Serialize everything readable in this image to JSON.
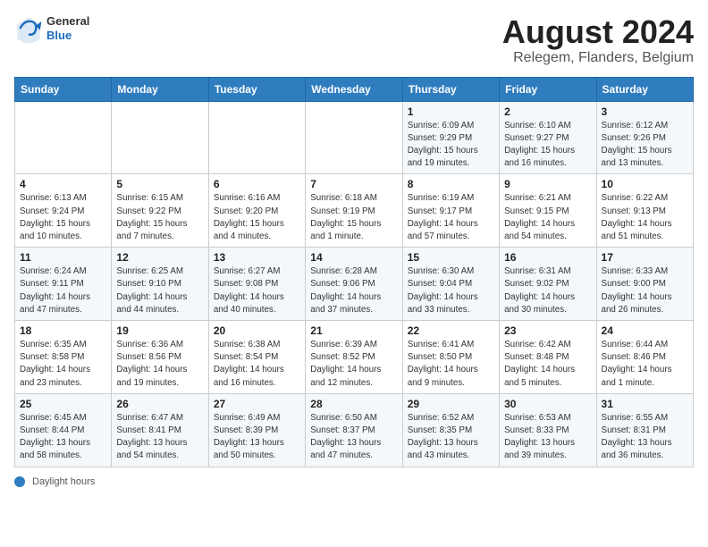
{
  "header": {
    "logo_general": "General",
    "logo_blue": "Blue",
    "month_year": "August 2024",
    "location": "Relegem, Flanders, Belgium"
  },
  "calendar": {
    "days_of_week": [
      "Sunday",
      "Monday",
      "Tuesday",
      "Wednesday",
      "Thursday",
      "Friday",
      "Saturday"
    ],
    "weeks": [
      [
        {
          "day": "",
          "info": ""
        },
        {
          "day": "",
          "info": ""
        },
        {
          "day": "",
          "info": ""
        },
        {
          "day": "",
          "info": ""
        },
        {
          "day": "1",
          "info": "Sunrise: 6:09 AM\nSunset: 9:29 PM\nDaylight: 15 hours\nand 19 minutes."
        },
        {
          "day": "2",
          "info": "Sunrise: 6:10 AM\nSunset: 9:27 PM\nDaylight: 15 hours\nand 16 minutes."
        },
        {
          "day": "3",
          "info": "Sunrise: 6:12 AM\nSunset: 9:26 PM\nDaylight: 15 hours\nand 13 minutes."
        }
      ],
      [
        {
          "day": "4",
          "info": "Sunrise: 6:13 AM\nSunset: 9:24 PM\nDaylight: 15 hours\nand 10 minutes."
        },
        {
          "day": "5",
          "info": "Sunrise: 6:15 AM\nSunset: 9:22 PM\nDaylight: 15 hours\nand 7 minutes."
        },
        {
          "day": "6",
          "info": "Sunrise: 6:16 AM\nSunset: 9:20 PM\nDaylight: 15 hours\nand 4 minutes."
        },
        {
          "day": "7",
          "info": "Sunrise: 6:18 AM\nSunset: 9:19 PM\nDaylight: 15 hours\nand 1 minute."
        },
        {
          "day": "8",
          "info": "Sunrise: 6:19 AM\nSunset: 9:17 PM\nDaylight: 14 hours\nand 57 minutes."
        },
        {
          "day": "9",
          "info": "Sunrise: 6:21 AM\nSunset: 9:15 PM\nDaylight: 14 hours\nand 54 minutes."
        },
        {
          "day": "10",
          "info": "Sunrise: 6:22 AM\nSunset: 9:13 PM\nDaylight: 14 hours\nand 51 minutes."
        }
      ],
      [
        {
          "day": "11",
          "info": "Sunrise: 6:24 AM\nSunset: 9:11 PM\nDaylight: 14 hours\nand 47 minutes."
        },
        {
          "day": "12",
          "info": "Sunrise: 6:25 AM\nSunset: 9:10 PM\nDaylight: 14 hours\nand 44 minutes."
        },
        {
          "day": "13",
          "info": "Sunrise: 6:27 AM\nSunset: 9:08 PM\nDaylight: 14 hours\nand 40 minutes."
        },
        {
          "day": "14",
          "info": "Sunrise: 6:28 AM\nSunset: 9:06 PM\nDaylight: 14 hours\nand 37 minutes."
        },
        {
          "day": "15",
          "info": "Sunrise: 6:30 AM\nSunset: 9:04 PM\nDaylight: 14 hours\nand 33 minutes."
        },
        {
          "day": "16",
          "info": "Sunrise: 6:31 AM\nSunset: 9:02 PM\nDaylight: 14 hours\nand 30 minutes."
        },
        {
          "day": "17",
          "info": "Sunrise: 6:33 AM\nSunset: 9:00 PM\nDaylight: 14 hours\nand 26 minutes."
        }
      ],
      [
        {
          "day": "18",
          "info": "Sunrise: 6:35 AM\nSunset: 8:58 PM\nDaylight: 14 hours\nand 23 minutes."
        },
        {
          "day": "19",
          "info": "Sunrise: 6:36 AM\nSunset: 8:56 PM\nDaylight: 14 hours\nand 19 minutes."
        },
        {
          "day": "20",
          "info": "Sunrise: 6:38 AM\nSunset: 8:54 PM\nDaylight: 14 hours\nand 16 minutes."
        },
        {
          "day": "21",
          "info": "Sunrise: 6:39 AM\nSunset: 8:52 PM\nDaylight: 14 hours\nand 12 minutes."
        },
        {
          "day": "22",
          "info": "Sunrise: 6:41 AM\nSunset: 8:50 PM\nDaylight: 14 hours\nand 9 minutes."
        },
        {
          "day": "23",
          "info": "Sunrise: 6:42 AM\nSunset: 8:48 PM\nDaylight: 14 hours\nand 5 minutes."
        },
        {
          "day": "24",
          "info": "Sunrise: 6:44 AM\nSunset: 8:46 PM\nDaylight: 14 hours\nand 1 minute."
        }
      ],
      [
        {
          "day": "25",
          "info": "Sunrise: 6:45 AM\nSunset: 8:44 PM\nDaylight: 13 hours\nand 58 minutes."
        },
        {
          "day": "26",
          "info": "Sunrise: 6:47 AM\nSunset: 8:41 PM\nDaylight: 13 hours\nand 54 minutes."
        },
        {
          "day": "27",
          "info": "Sunrise: 6:49 AM\nSunset: 8:39 PM\nDaylight: 13 hours\nand 50 minutes."
        },
        {
          "day": "28",
          "info": "Sunrise: 6:50 AM\nSunset: 8:37 PM\nDaylight: 13 hours\nand 47 minutes."
        },
        {
          "day": "29",
          "info": "Sunrise: 6:52 AM\nSunset: 8:35 PM\nDaylight: 13 hours\nand 43 minutes."
        },
        {
          "day": "30",
          "info": "Sunrise: 6:53 AM\nSunset: 8:33 PM\nDaylight: 13 hours\nand 39 minutes."
        },
        {
          "day": "31",
          "info": "Sunrise: 6:55 AM\nSunset: 8:31 PM\nDaylight: 13 hours\nand 36 minutes."
        }
      ]
    ]
  },
  "footer": {
    "label": "Daylight hours"
  }
}
